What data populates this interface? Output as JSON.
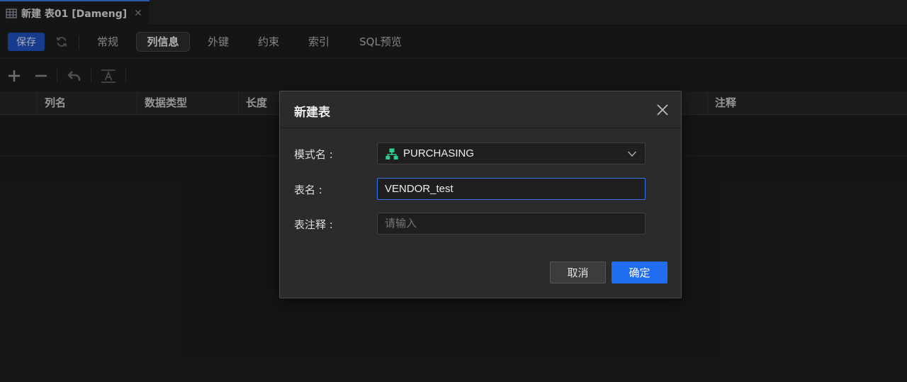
{
  "tab": {
    "title": "新建 表01 [Dameng]"
  },
  "toolbar": {
    "save_label": "保存",
    "subtabs": [
      {
        "label": "常规"
      },
      {
        "label": "列信息"
      },
      {
        "label": "外键"
      },
      {
        "label": "约束"
      },
      {
        "label": "索引"
      },
      {
        "label": "SQL预览"
      }
    ],
    "active_subtab": "列信息"
  },
  "grid": {
    "columns": [
      {
        "label": "列名"
      },
      {
        "label": "数据类型"
      },
      {
        "label": "长度"
      },
      {
        "label": "注释"
      }
    ]
  },
  "dialog": {
    "title": "新建表",
    "schema_label": "模式名 :",
    "schema_value": "PURCHASING",
    "table_label": "表名 :",
    "table_value": "VENDOR_test",
    "comment_label": "表注释 :",
    "comment_placeholder": "请输入",
    "cancel_label": "取消",
    "ok_label": "确定"
  },
  "colors": {
    "accent": "#1f6ef2",
    "save_button": "#2152c4",
    "schema_icon": "#2fce8c"
  }
}
